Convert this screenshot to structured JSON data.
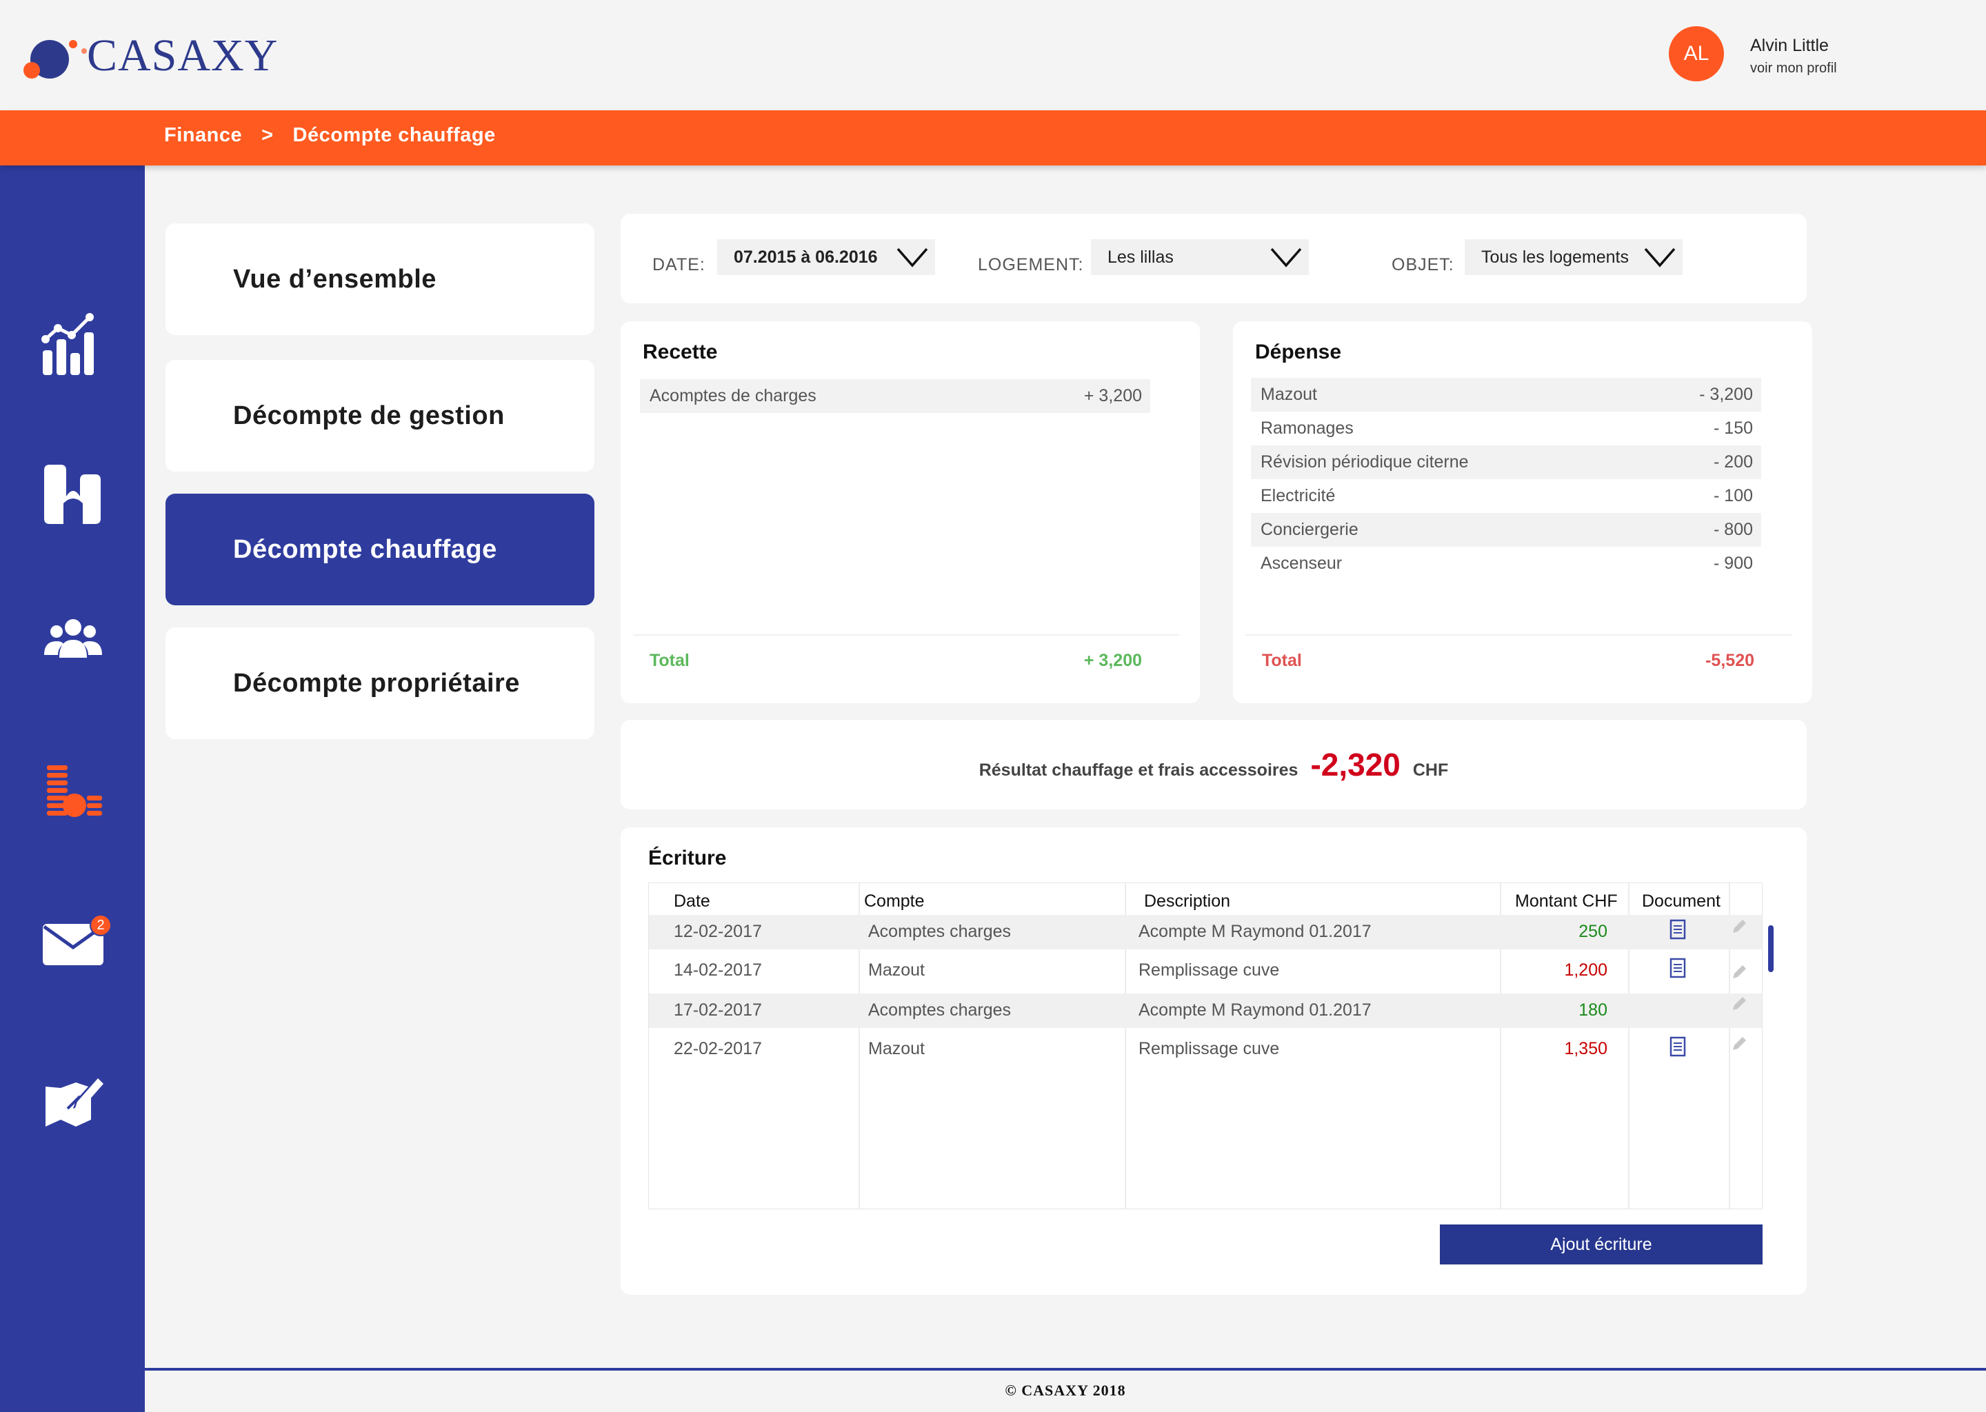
{
  "brand": {
    "name": "CASAXY"
  },
  "user": {
    "initials": "AL",
    "name": "Alvin Little",
    "profile_link": "voir mon profil"
  },
  "breadcrumb": {
    "section": "Finance",
    "separator": ">",
    "page": "Décompte chauffage"
  },
  "sidebar": {
    "items": [
      {
        "icon": "analytics-chart-icon"
      },
      {
        "icon": "buildings-icon"
      },
      {
        "icon": "people-group-icon"
      },
      {
        "icon": "coins-finance-icon",
        "active": true
      },
      {
        "icon": "mail-icon",
        "badge": "2"
      },
      {
        "icon": "document-edit-icon"
      }
    ]
  },
  "menu": {
    "items": [
      {
        "label": "Vue d’ensemble"
      },
      {
        "label": "Décompte de gestion"
      },
      {
        "label": "Décompte chauffage",
        "active": true
      },
      {
        "label": "Décompte propriétaire"
      }
    ]
  },
  "filters": {
    "date": {
      "label": "DATE:",
      "value": "07.2015 à 06.2016"
    },
    "logement": {
      "label": "LOGEMENT:",
      "value": "Les lillas"
    },
    "objet": {
      "label": "OBJET:",
      "value": "Tous les logements"
    }
  },
  "recette": {
    "title": "Recette",
    "lines": [
      {
        "label": "Acomptes de charges",
        "amount": "+ 3,200"
      }
    ],
    "total_label": "Total",
    "total_value": "+ 3,200"
  },
  "depense": {
    "title": "Dépense",
    "lines": [
      {
        "label": "Mazout",
        "amount": "- 3,200"
      },
      {
        "label": "Ramonages",
        "amount": "- 150"
      },
      {
        "label": "Révision périodique citerne",
        "amount": "- 200"
      },
      {
        "label": "Electricité",
        "amount": "- 100"
      },
      {
        "label": "Conciergerie",
        "amount": "- 800"
      },
      {
        "label": "Ascenseur",
        "amount": "- 900"
      }
    ],
    "total_label": "Total",
    "total_value": "-5,520"
  },
  "result": {
    "label": "Résultat chauffage et frais accessoires",
    "value": "-2,320",
    "unit": "CHF"
  },
  "ecriture": {
    "title": "Écriture",
    "columns": [
      "Date",
      "Compte",
      "Description",
      "Montant CHF",
      "Document"
    ],
    "rows": [
      {
        "date": "12-02-2017",
        "compte": "Acomptes charges",
        "description": "Acompte M Raymond 01.2017",
        "montant": "250",
        "positive": true,
        "has_doc": true
      },
      {
        "date": "14-02-2017",
        "compte": "Mazout",
        "description": "Remplissage cuve",
        "montant": "1,200",
        "positive": false,
        "has_doc": true
      },
      {
        "date": "17-02-2017",
        "compte": "Acomptes charges",
        "description": "Acompte M Raymond 01.2017",
        "montant": "180",
        "positive": true,
        "has_doc": false
      },
      {
        "date": "22-02-2017",
        "compte": "Mazout",
        "description": "Remplissage cuve",
        "montant": "1,350",
        "positive": false,
        "has_doc": true
      }
    ],
    "add_button": "Ajout écriture"
  },
  "footer": {
    "text": "© CASAXY 2018"
  },
  "colors": {
    "accent_orange": "#ff5a1f",
    "brand_blue": "#2f3c9e",
    "positive_green": "#5cb85c",
    "negative_red": "#e05252",
    "amount_green": "#1a8a1a",
    "amount_red": "#c80000"
  }
}
